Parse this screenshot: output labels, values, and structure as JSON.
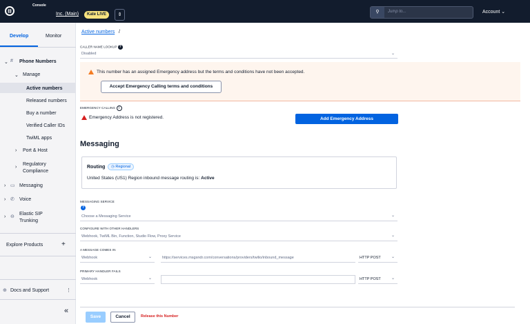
{
  "topbar": {
    "console_label": "Console",
    "account_name": "Inc. (Main)",
    "live_badge": "Kate LIVE",
    "account_switch_icon": "updown-chevron-icon",
    "search_placeholder": "Jump to...",
    "account_menu": "Account"
  },
  "sidebar": {
    "tabs": [
      "Develop",
      "Monitor"
    ],
    "phone_numbers": "Phone Numbers",
    "manage": "Manage",
    "active_numbers": "Active numbers",
    "released_numbers": "Released numbers",
    "buy_number": "Buy a number",
    "verified_caller_ids": "Verified Caller IDs",
    "twiml_apps": "TwiML apps",
    "port_host": "Port & Host",
    "regulatory_1": "Regulatory",
    "regulatory_2": "Compliance",
    "messaging": "Messaging",
    "voice": "Voice",
    "elastic_1": "Elastic SIP",
    "elastic_2": "Trunking",
    "explore_products": "Explore Products",
    "docs_support": "Docs and Support",
    "collapse": "«"
  },
  "main": {
    "breadcrumb": "Active numbers",
    "breadcrumb_sep": "/",
    "caller_name_lookup_label": "CALLER NAME LOOKUP",
    "caller_name_lookup_value": "Disabled",
    "warning_text": "This number has an assigned Emergency address but the terms and conditions have not been accepted.",
    "accept_button": "Accept Emergency Calling terms and conditions",
    "emergency_calling_label": "EMERGENCY CALLING",
    "emergency_status": "Emergency Address is not registered.",
    "add_emergency_button": "Add Emergency Address",
    "messaging_heading": "Messaging",
    "routing_title": "Routing",
    "regional_badge": "Regional",
    "routing_text": "United States (US1) Region inbound message routing is:",
    "routing_status": "Active",
    "messaging_service_label": "MESSAGING SERVICE",
    "messaging_service_placeholder": "Choose a Messaging Service",
    "configure_label": "CONFIGURE WITH OTHER HANDLERS",
    "configure_value": "Webhook, TwiML Bin, Function, Studio Flow, Proxy Service",
    "message_comes_in_label": "A MESSAGE COMES IN",
    "message_comes_in_type": "Webhook",
    "message_comes_in_url": "https://services.msgsndr.com/conversations/providers/twilio/inbound_message",
    "message_comes_in_method": "HTTP POST",
    "primary_fails_label": "PRIMARY HANDLER FAILS",
    "primary_fails_type": "Webhook",
    "primary_fails_url": "",
    "primary_fails_method": "HTTP POST",
    "save_button": "Save",
    "cancel_button": "Cancel",
    "release_link": "Release this Number"
  }
}
